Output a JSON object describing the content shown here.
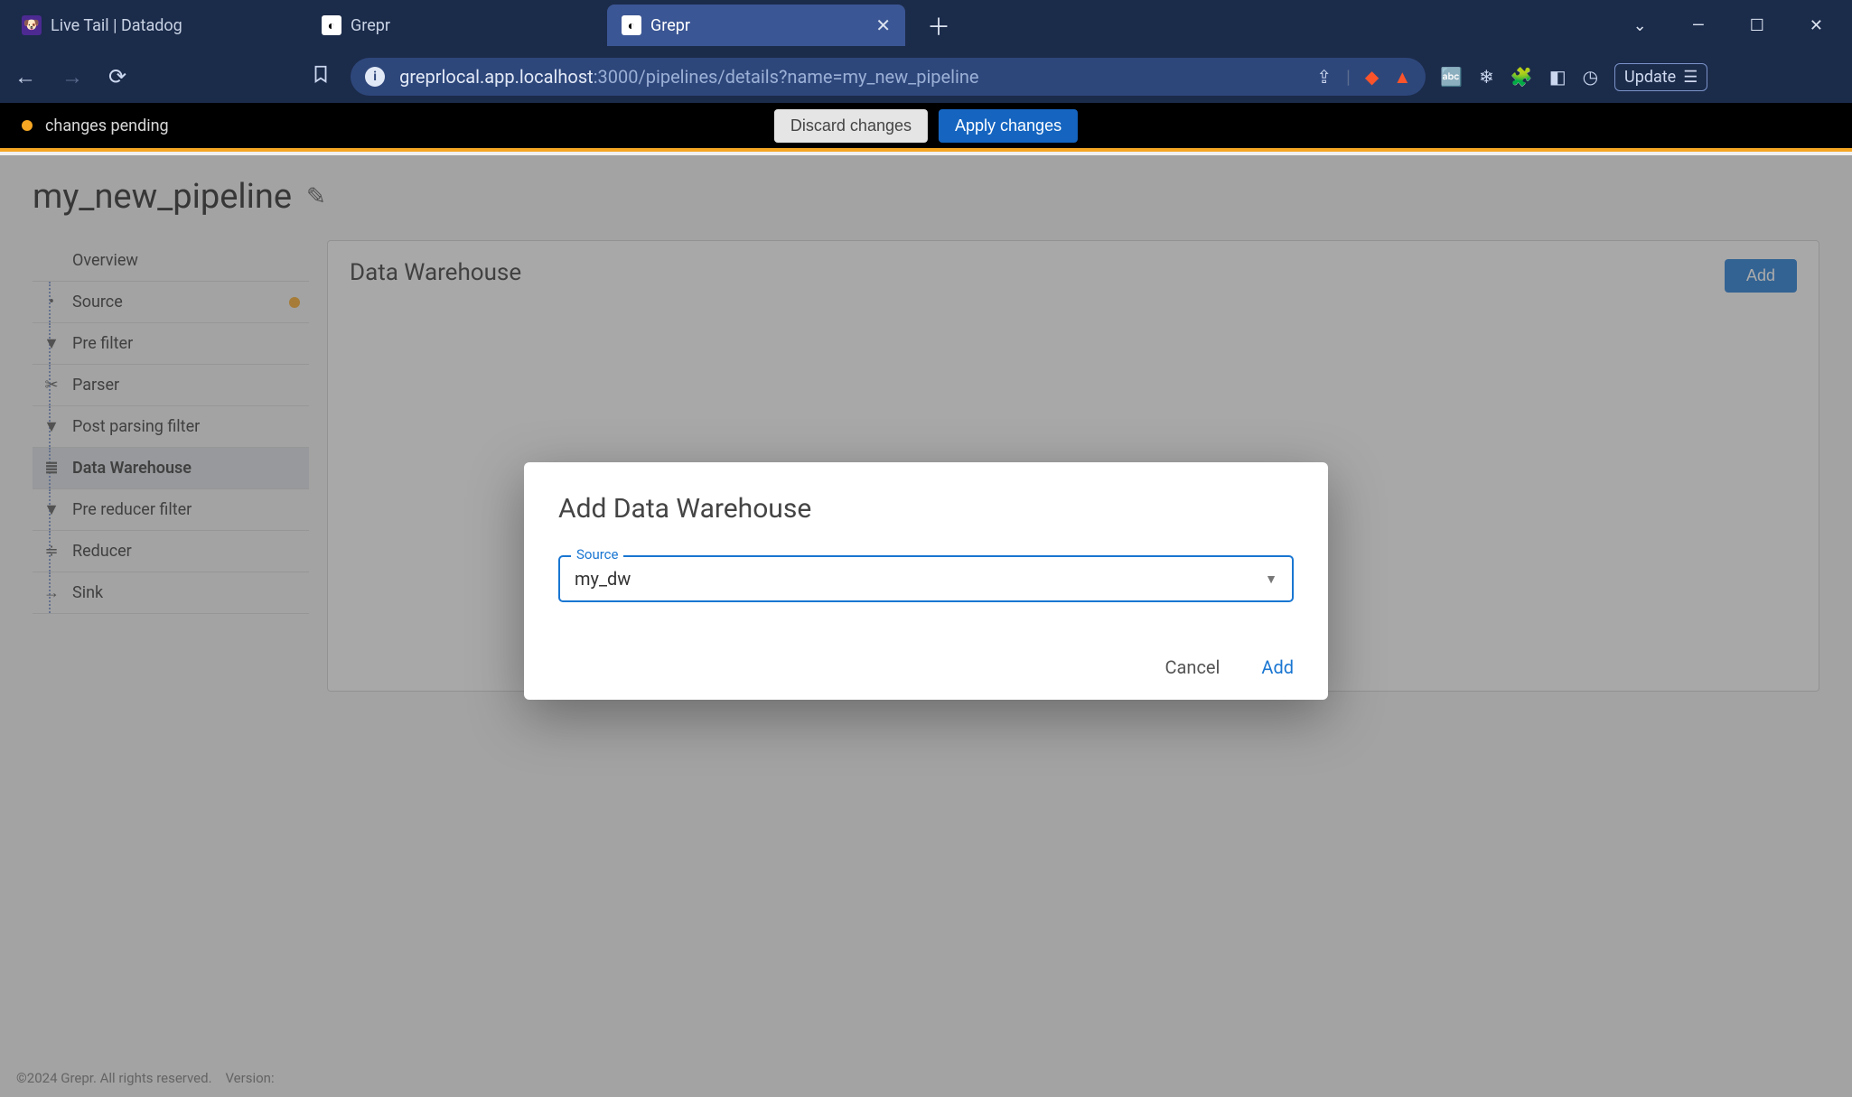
{
  "browser": {
    "tabs": [
      {
        "title": "Live Tail | Datadog",
        "active": false
      },
      {
        "title": "Grepr",
        "active": false
      },
      {
        "title": "Grepr",
        "active": true
      }
    ],
    "url_prefix": "greprlocal.app.localhost",
    "url_suffix": ":3000/pipelines/details?name=my_new_pipeline",
    "update_label": "Update"
  },
  "topbar": {
    "status": "changes pending",
    "discard": "Discard changes",
    "apply": "Apply changes"
  },
  "page": {
    "title": "my_new_pipeline"
  },
  "sidebar": {
    "items": [
      {
        "label": "Overview",
        "icon": "",
        "status": false,
        "selected": false
      },
      {
        "label": "Source",
        "icon": "•",
        "status": true,
        "selected": false
      },
      {
        "label": "Pre filter",
        "icon": "▼",
        "status": false,
        "selected": false
      },
      {
        "label": "Parser",
        "icon": "✂",
        "status": false,
        "selected": false
      },
      {
        "label": "Post parsing filter",
        "icon": "▼",
        "status": false,
        "selected": false
      },
      {
        "label": "Data Warehouse",
        "icon": "≣",
        "status": false,
        "selected": true
      },
      {
        "label": "Pre reducer filter",
        "icon": "▼",
        "status": false,
        "selected": false
      },
      {
        "label": "Reducer",
        "icon": "≑",
        "status": false,
        "selected": false
      },
      {
        "label": "Sink",
        "icon": "→",
        "status": false,
        "selected": false
      }
    ]
  },
  "main": {
    "heading": "Data Warehouse",
    "add_button": "Add"
  },
  "modal": {
    "title": "Add Data Warehouse",
    "source_label": "Source",
    "source_value": "my_dw",
    "cancel": "Cancel",
    "add": "Add"
  },
  "footer": {
    "copyright": "©2024 Grepr. All rights reserved.",
    "version_label": "Version:"
  }
}
